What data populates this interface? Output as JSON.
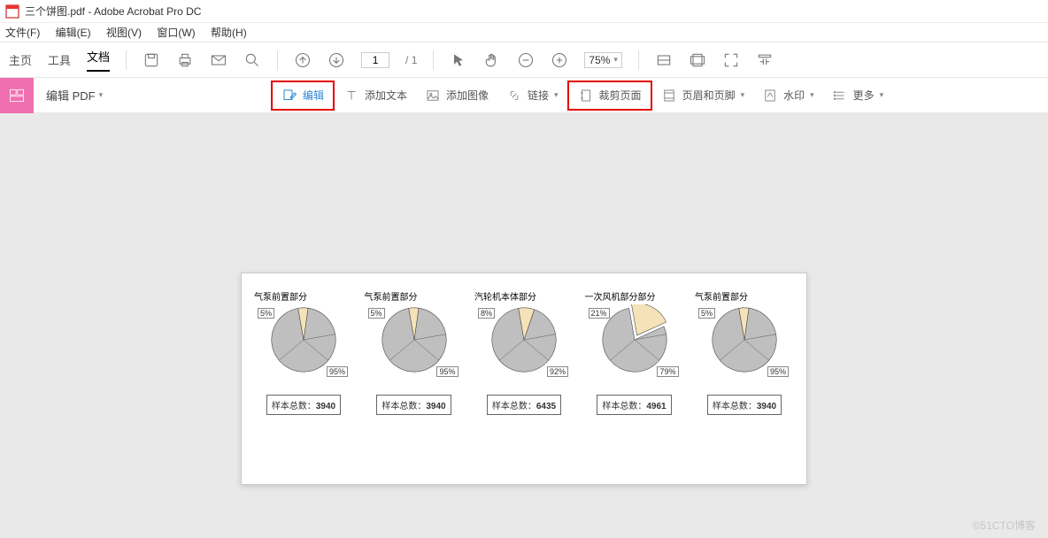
{
  "title": "三个饼图.pdf - Adobe Acrobat Pro DC",
  "menus": {
    "file": "文件(F)",
    "edit": "编辑(E)",
    "view": "视图(V)",
    "window": "窗口(W)",
    "help": "帮助(H)"
  },
  "tabs": {
    "home": "主页",
    "tools": "工具",
    "doc": "文档"
  },
  "page": {
    "current": "1",
    "sep": "/ 1"
  },
  "zoom": "75%",
  "editpdf": "编辑 PDF",
  "tool2": {
    "edit": "编辑",
    "addtext": "添加文本",
    "addimg": "添加图像",
    "link": "链接",
    "crop": "裁剪页面",
    "header": "页眉和页脚",
    "watermark": "水印",
    "more": "更多"
  },
  "chart_data": [
    {
      "type": "pie",
      "title": "气泵前置部分",
      "slices": [
        {
          "label": "5%",
          "value": 5
        },
        {
          "label": "95%",
          "value": 95
        }
      ],
      "sample_label": "样本总数：",
      "sample": "3940"
    },
    {
      "type": "pie",
      "title": "气泵前置部分",
      "slices": [
        {
          "label": "5%",
          "value": 5
        },
        {
          "label": "95%",
          "value": 95
        }
      ],
      "sample_label": "样本总数：",
      "sample": "3940"
    },
    {
      "type": "pie",
      "title": "汽轮机本体部分",
      "slices": [
        {
          "label": "8%",
          "value": 8
        },
        {
          "label": "92%",
          "value": 92
        }
      ],
      "sample_label": "样本总数：",
      "sample": "6435"
    },
    {
      "type": "pie",
      "title": "一次风机部分部分",
      "slices": [
        {
          "label": "21%",
          "value": 21
        },
        {
          "label": "79%",
          "value": 79
        }
      ],
      "sample_label": "样本总数：",
      "sample": "4961"
    },
    {
      "type": "pie",
      "title": "气泵前置部分",
      "slices": [
        {
          "label": "5%",
          "value": 5
        },
        {
          "label": "95%",
          "value": 95
        }
      ],
      "sample_label": "样本总数：",
      "sample": "3940"
    }
  ],
  "watermark": "©51CTO博客"
}
